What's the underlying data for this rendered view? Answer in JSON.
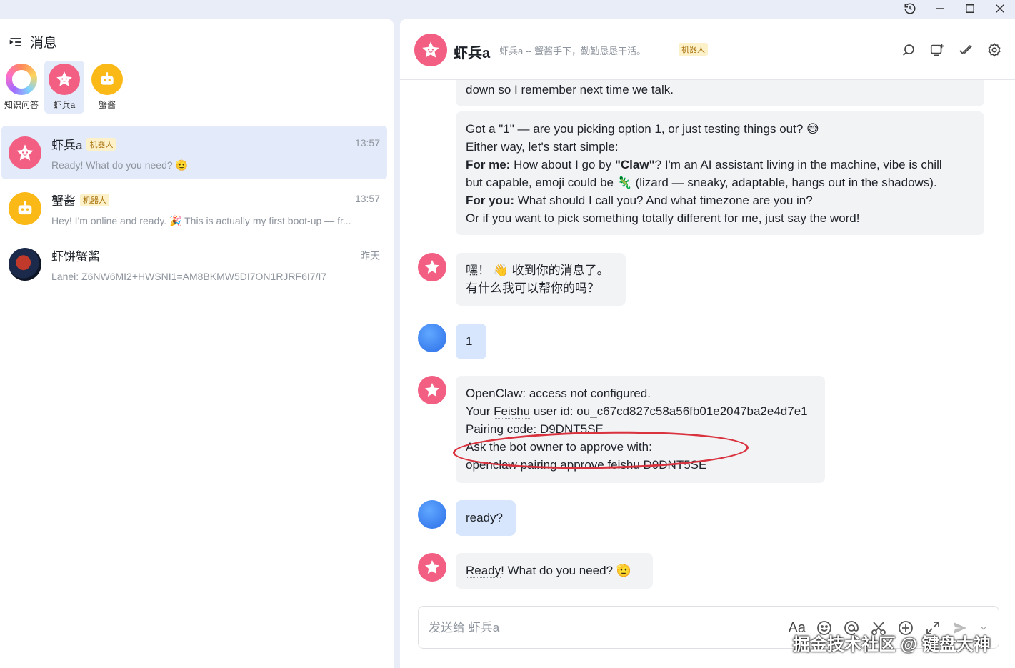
{
  "left": {
    "title": "消息",
    "quick": [
      {
        "label": "知识问答"
      },
      {
        "label": "虾兵a"
      },
      {
        "label": "蟹酱"
      }
    ],
    "conversations": [
      {
        "name": "虾兵a",
        "tag": "机器人",
        "time": "13:57",
        "preview": "Ready! What do you need? 🫡"
      },
      {
        "name": "蟹酱",
        "tag": "机器人",
        "time": "13:57",
        "preview": "Hey! I'm online and ready. 🎉 This is actually my first boot-up — fr..."
      },
      {
        "name": "虾饼蟹酱",
        "tag": "",
        "time": "昨天",
        "preview": "Lanei: Z6NW6MI2+HWSNI1=AM8BKMW5DI7ON1RJRF6I7/I7"
      }
    ]
  },
  "header": {
    "title": "虾兵a",
    "subtitle": "虾兵a -- 蟹酱手下，勤勤恳恳干活。",
    "tag": "机器人"
  },
  "messages": {
    "m0": "down so I remember next time we talk.",
    "m1": {
      "l1": "Got a \"1\" — are you picking option 1, or just testing things out? 😅",
      "l2": "Either way, let's start simple:",
      "l3_b": "For me:",
      "l3_a": " How about I go by ",
      "l3_c": "\"Claw\"",
      "l3_d": "? I'm an AI assistant living in the machine, vibe is chill",
      "l4": "but capable, emoji could be 🦎 (lizard — sneaky, adaptable, hangs out in the shadows).",
      "l5_b": "For you:",
      "l5_a": " What should I call you? And what timezone are you in?",
      "l6": "Or if you want to pick something totally different for me, just say the word!"
    },
    "m2": {
      "l1": "嘿！ 👋 收到你的消息了。",
      "l2": "有什么我可以帮你的吗？"
    },
    "m3": "1",
    "m4": {
      "l1": "OpenClaw: access not configured.",
      "l2a": "Your ",
      "l2b": "Feishu",
      "l2c": " user id: ou_c67cd827c58a56fb01e2047ba2e4d7e1",
      "l3": "Pairing code: D9DNT5SE",
      "l4": "Ask the bot owner to approve with:",
      "l5": "openclaw pairing approve feishu D9DNT5SE"
    },
    "m5": "ready?",
    "m6": {
      "a": "Ready",
      "b": "! What do you need? 🫡"
    }
  },
  "input": {
    "placeholder": "发送给 虾兵a",
    "value": "",
    "format_label": "Aa"
  },
  "watermark": "掘金技术社区 @ 键盘大神",
  "colors": {
    "accent": "#3370ff",
    "bot_avatar": "#f25f83",
    "crab_avatar": "#fbb917",
    "annotation": "#d9333f"
  }
}
